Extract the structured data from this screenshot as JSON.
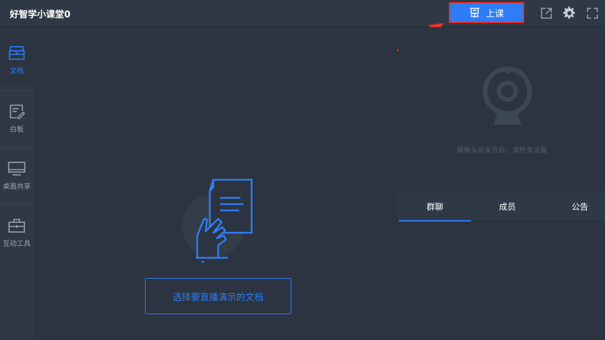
{
  "header": {
    "title": "好智学小课堂0",
    "start_class_label": "上课",
    "icons": [
      "share-icon",
      "gear-icon",
      "fullscreen-icon"
    ]
  },
  "sidebar": {
    "items": [
      {
        "label": "文档",
        "icon": "document-icon",
        "active": true
      },
      {
        "label": "白板",
        "icon": "whiteboard-icon",
        "active": false
      },
      {
        "label": "桌面共享",
        "icon": "screen-share-icon",
        "active": false
      },
      {
        "label": "互动工具",
        "icon": "toolbox-icon",
        "active": false
      }
    ]
  },
  "main": {
    "select_doc_label": "选择要直播演示的文档"
  },
  "camera": {
    "status_text": "摄像头尚未开启，请检查设备"
  },
  "tabs": [
    {
      "label": "群聊",
      "active": true
    },
    {
      "label": "成员",
      "active": false
    },
    {
      "label": "公告",
      "active": false
    }
  ],
  "colors": {
    "accent": "#2f7cf6",
    "highlight": "#e8312e",
    "background": "#2b3440",
    "panel": "#2f3945"
  }
}
